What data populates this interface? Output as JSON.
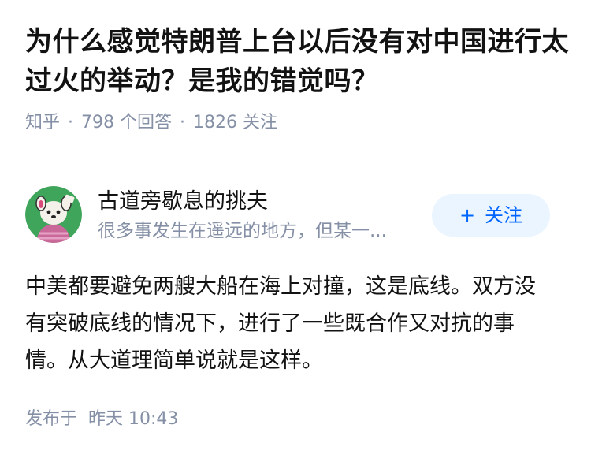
{
  "question": {
    "title": "为什么感觉特朗普上台以后没有对中国进行太过火的举动？是我的错觉吗？",
    "source": "知乎",
    "answers_count": "798",
    "answers_label": "个回答",
    "followers_count": "1826",
    "followers_label": "关注",
    "separator": "·"
  },
  "answer": {
    "author_name": "古道旁歇息的挑夫",
    "author_bio": "很多事发生在遥远的地方，但某一...",
    "avatar_icon": "cartoon-animal-avatar-icon",
    "follow_button": {
      "icon": "plus-icon",
      "plus": "+",
      "label": "关注"
    },
    "content": "中美都要避免两艘大船在海上对撞，这是底线。双方没有突破底线的情况下，进行了一些既合作又对抗的事情。从大道理简单说就是这样。",
    "published_label": "发布于",
    "published_time": "昨天 10:43"
  },
  "colors": {
    "primary": "#0066ff",
    "muted": "#8590a6",
    "follow_bg": "#ebf5ff",
    "divider": "#ebebeb",
    "avatar_bg": "#3fa55b"
  }
}
